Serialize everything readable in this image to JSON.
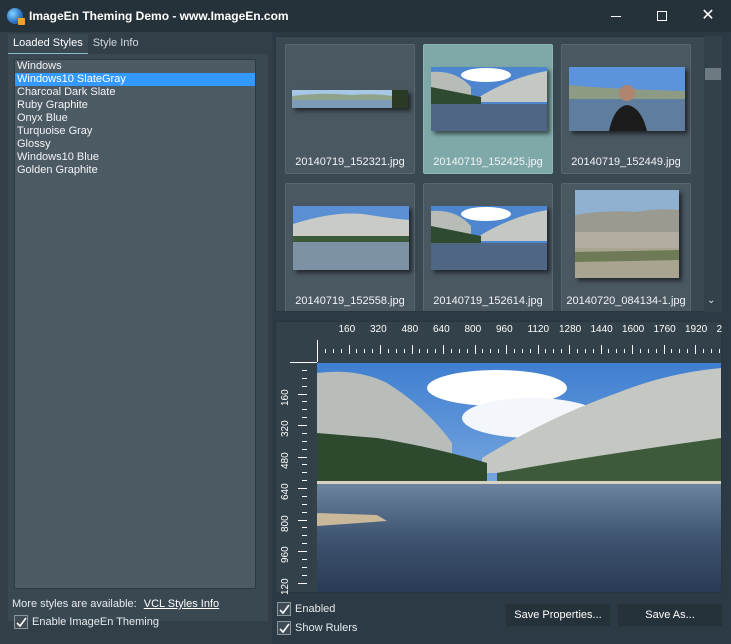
{
  "window": {
    "title": "ImageEn Theming Demo - www.ImageEn.com",
    "icon": "globe-icon",
    "controls": {
      "minimize": "minimize-icon",
      "maximize": "maximize-icon",
      "close": "close-icon"
    }
  },
  "left_panel": {
    "tabs": [
      {
        "label": "Loaded Styles",
        "active": true
      },
      {
        "label": "Style Info",
        "active": false
      }
    ],
    "styles": [
      {
        "label": "Windows",
        "selected": false
      },
      {
        "label": "Windows10 SlateGray",
        "selected": true
      },
      {
        "label": "Charcoal Dark Slate",
        "selected": false
      },
      {
        "label": "Ruby Graphite",
        "selected": false
      },
      {
        "label": "Onyx Blue",
        "selected": false
      },
      {
        "label": "Turquoise Gray",
        "selected": false
      },
      {
        "label": "Glossy",
        "selected": false
      },
      {
        "label": "Windows10 Blue",
        "selected": false
      },
      {
        "label": "Golden Graphite",
        "selected": false
      }
    ],
    "more_styles_text": "More styles are available:",
    "more_styles_link": "VCL Styles Info",
    "enable_theming": {
      "label": "Enable ImageEn Theming",
      "checked": true
    }
  },
  "thumbnails": [
    {
      "filename": "20140719_152321.jpg",
      "selected": false,
      "kind": "panorama"
    },
    {
      "filename": "20140719_152425.jpg",
      "selected": true,
      "kind": "lake"
    },
    {
      "filename": "20140719_152449.jpg",
      "selected": false,
      "kind": "portrait"
    },
    {
      "filename": "20140719_152558.jpg",
      "selected": false,
      "kind": "lake2"
    },
    {
      "filename": "20140719_152614.jpg",
      "selected": false,
      "kind": "lake"
    },
    {
      "filename": "20140720_084134-1.jpg",
      "selected": false,
      "kind": "desert"
    }
  ],
  "scrollbar": {
    "down_icon": "chevron-down-icon"
  },
  "viewer": {
    "h_ruler_labels": [
      "160",
      "320",
      "480",
      "640",
      "800",
      "960",
      "1120",
      "1280",
      "1440",
      "1600",
      "1760",
      "1920",
      "2"
    ],
    "v_ruler_labels": [
      "160",
      "320",
      "480",
      "640",
      "800",
      "960",
      "120"
    ]
  },
  "options": {
    "enabled": {
      "label": "Enabled",
      "checked": true
    },
    "show_rulers": {
      "label": "Show Rulers",
      "checked": true
    }
  },
  "buttons": {
    "save_properties": "Save Properties...",
    "save_as": "Save As..."
  },
  "colors": {
    "selection": "#3399ff",
    "thumb_selected": "#7fa9a8",
    "background": "#323f48",
    "titlebar": "#26323a"
  }
}
